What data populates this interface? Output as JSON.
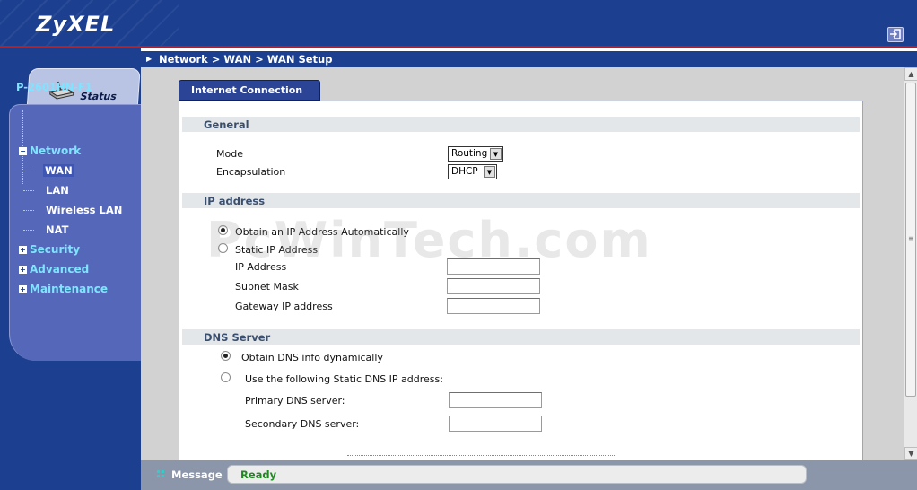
{
  "header": {
    "logo": "ZyXEL"
  },
  "nav": {
    "status_label": "Status",
    "model": "P-2601HN-F1",
    "items": [
      {
        "label": "Network",
        "expanded": true,
        "children": [
          {
            "label": "WAN",
            "selected": true
          },
          {
            "label": "LAN"
          },
          {
            "label": "Wireless LAN"
          },
          {
            "label": "NAT"
          }
        ]
      },
      {
        "label": "Security",
        "expanded": false
      },
      {
        "label": "Advanced",
        "expanded": false
      },
      {
        "label": "Maintenance",
        "expanded": false
      }
    ]
  },
  "breadcrumb": "Network > WAN > WAN Setup",
  "tabs": [
    {
      "label": "Internet Connection",
      "active": true
    }
  ],
  "general": {
    "title": "General",
    "mode_label": "Mode",
    "mode_value": "Routing",
    "encapsulation_label": "Encapsulation",
    "encapsulation_value": "DHCP"
  },
  "ip_address": {
    "title": "IP address",
    "obtain_auto_label": "Obtain an IP Address Automatically",
    "obtain_auto_selected": true,
    "static_label": "Static IP Address",
    "static_selected": false,
    "ip_label": "IP Address",
    "ip_value": "",
    "mask_label": "Subnet Mask",
    "mask_value": "",
    "gateway_label": "Gateway IP address",
    "gateway_value": ""
  },
  "dns": {
    "title": "DNS Server",
    "dynamic_label": "Obtain DNS info dynamically",
    "dynamic_selected": true,
    "static_label": "Use the following Static DNS IP address:",
    "static_selected": false,
    "primary_label": "Primary DNS server:",
    "primary_value": "",
    "secondary_label": "Secondary DNS server:",
    "secondary_value": ""
  },
  "watermark": "PcWinTech.com",
  "message": {
    "label": "Message",
    "text": "Ready"
  },
  "colors": {
    "header_bg": "#1c3f8f",
    "accent_red": "#b81f24",
    "nav_link": "#7fe4ff",
    "status_ready": "#1f8a1f"
  }
}
